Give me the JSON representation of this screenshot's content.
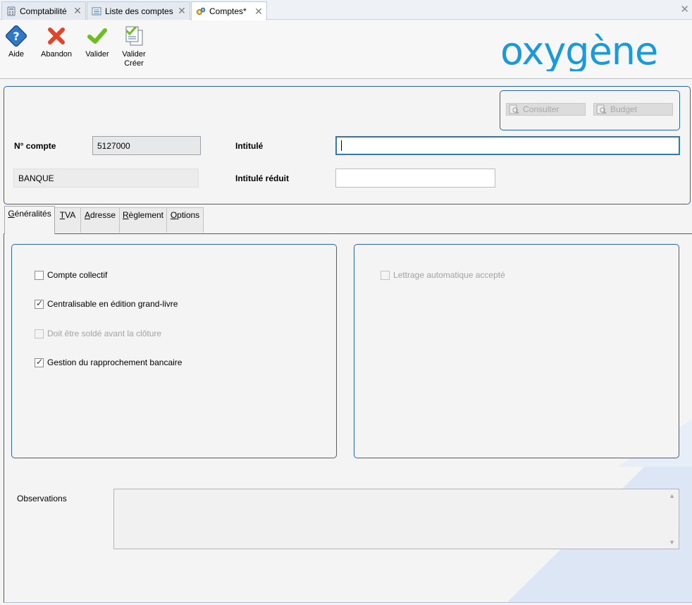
{
  "tabs": [
    {
      "label": "Comptabilité"
    },
    {
      "label": "Liste des comptes"
    },
    {
      "label": "Comptes*"
    }
  ],
  "toolbar": {
    "aide": "Aide",
    "abandon": "Abandon",
    "valider": "Valider",
    "valider_creer_1": "Valider",
    "valider_creer_2": "Créer"
  },
  "logo_text": "oxygène",
  "header": {
    "consulter": "Consulter",
    "budget": "Budget",
    "num_compte_label": "N° compte",
    "num_compte_value": "5127000",
    "intitule_label": "Intitulé",
    "intitule_value": "",
    "type_value": "BANQUE",
    "intitule_reduit_label": "Intitulé réduit",
    "intitule_reduit_value": ""
  },
  "section_tabs": [
    {
      "label": "Généralités",
      "key": "G",
      "rest": "énéralités"
    },
    {
      "label": "TVA",
      "key": "T",
      "rest": "VA"
    },
    {
      "label": "Adresse",
      "key": "A",
      "rest": "dresse"
    },
    {
      "label": "Règlement",
      "key": "R",
      "rest": "èglement"
    },
    {
      "label": "Options",
      "key": "O",
      "rest": "ptions"
    }
  ],
  "options_left": [
    {
      "label": "Compte collectif",
      "checked": false,
      "enabled": true
    },
    {
      "label": "Centralisable en édition grand-livre",
      "checked": true,
      "enabled": true
    },
    {
      "label": "Doit être soldé avant la clôture",
      "checked": false,
      "enabled": false
    },
    {
      "label": "Gestion du rapprochement bancaire",
      "checked": true,
      "enabled": true
    }
  ],
  "options_right": [
    {
      "label": "Lettrage automatique accepté",
      "checked": false,
      "enabled": false
    }
  ],
  "observations_label": "Observations",
  "observations_value": "",
  "colors": {
    "accent": "#2f63a8",
    "logo": "#1a9ad6",
    "abandon": "#e0452a",
    "valider": "#6cbf1f"
  }
}
